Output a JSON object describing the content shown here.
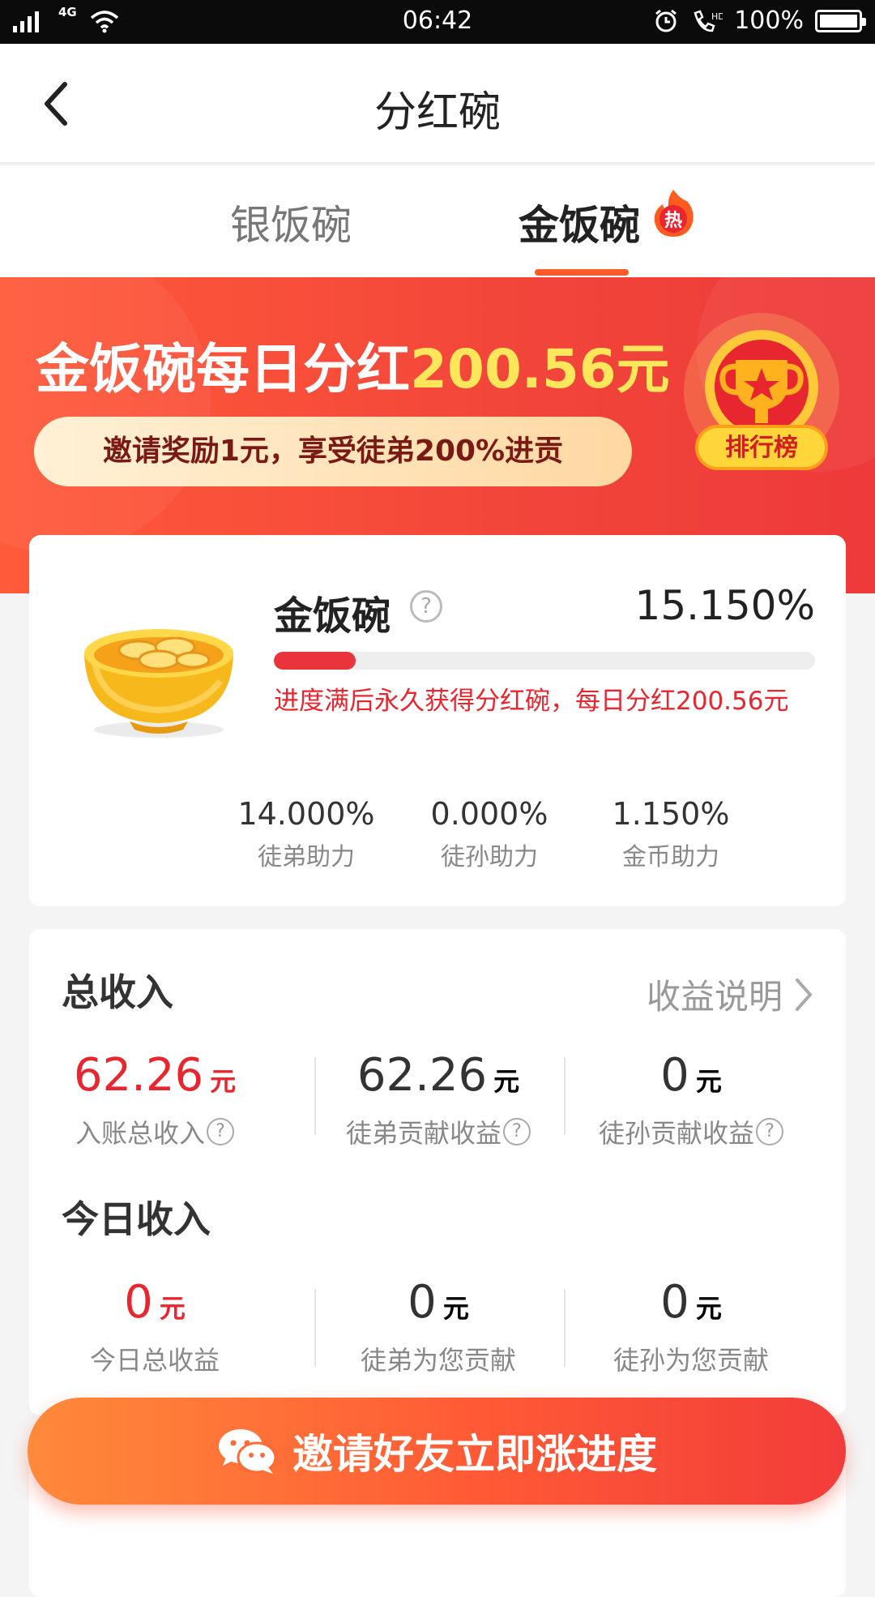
{
  "status_bar": {
    "network": "4G",
    "time": "06:42",
    "battery": "100%",
    "hd": "HD"
  },
  "nav": {
    "title": "分红碗"
  },
  "tabs": [
    {
      "label": "银饭碗",
      "active": false
    },
    {
      "label": "金饭碗",
      "active": true,
      "badge": "热"
    }
  ],
  "banner": {
    "title_prefix": "金饭碗每日分红",
    "amount": "200.56元",
    "invite_text": "邀请奖励1元，享受徒弟200%进贡",
    "rank_label": "排行榜"
  },
  "gold_bowl": {
    "name": "金饭碗",
    "help": "?",
    "percent": "15.150%",
    "progress_fraction": 0.1515,
    "note": "进度满后永久获得分红碗，每日分红200.56元",
    "assists": [
      {
        "value": "14.000%",
        "label": "徒弟助力"
      },
      {
        "value": "0.000%",
        "label": "徒孙助力"
      },
      {
        "value": "1.150%",
        "label": "金币助力"
      }
    ]
  },
  "total_income": {
    "title": "总收入",
    "explain_link": "收益说明",
    "items": [
      {
        "value": "62.26",
        "unit": "元",
        "label": "入账总收入",
        "help": "?"
      },
      {
        "value": "62.26",
        "unit": "元",
        "label": "徒弟贡献收益",
        "help": "?"
      },
      {
        "value": "0",
        "unit": "元",
        "label": "徒孙贡献收益",
        "help": "?"
      }
    ]
  },
  "today_income": {
    "title": "今日收入",
    "items": [
      {
        "value": "0",
        "unit": "元",
        "label": "今日总收益"
      },
      {
        "value": "0",
        "unit": "元",
        "label": "徒弟为您贡献"
      },
      {
        "value": "0",
        "unit": "元",
        "label": "徒孙为您贡献"
      }
    ]
  },
  "invite_button": {
    "label": "邀请好友立即涨进度"
  },
  "colors": {
    "accent": "#e8262f",
    "banner": "#f2453a",
    "highlight": "#ffe65a"
  }
}
